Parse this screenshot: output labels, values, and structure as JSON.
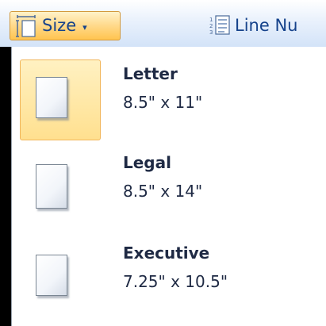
{
  "ribbon": {
    "size_button": {
      "label": "Size",
      "icon": "page-size-icon",
      "caret": "▾"
    },
    "line_numbers": {
      "label": "Line Nu",
      "icon": "line-numbers-icon"
    }
  },
  "size_menu": {
    "items": [
      {
        "name": "Letter",
        "dimensions": "8.5\" x 11\"",
        "selected": true
      },
      {
        "name": "Legal",
        "dimensions": "8.5\" x 14\"",
        "selected": false
      },
      {
        "name": "Executive",
        "dimensions": "7.25\" x 10.5\"",
        "selected": false
      }
    ]
  },
  "colors": {
    "ribbon_text": "#15428b",
    "highlight": "#ffd98a",
    "highlight_border": "#f2b65a"
  }
}
